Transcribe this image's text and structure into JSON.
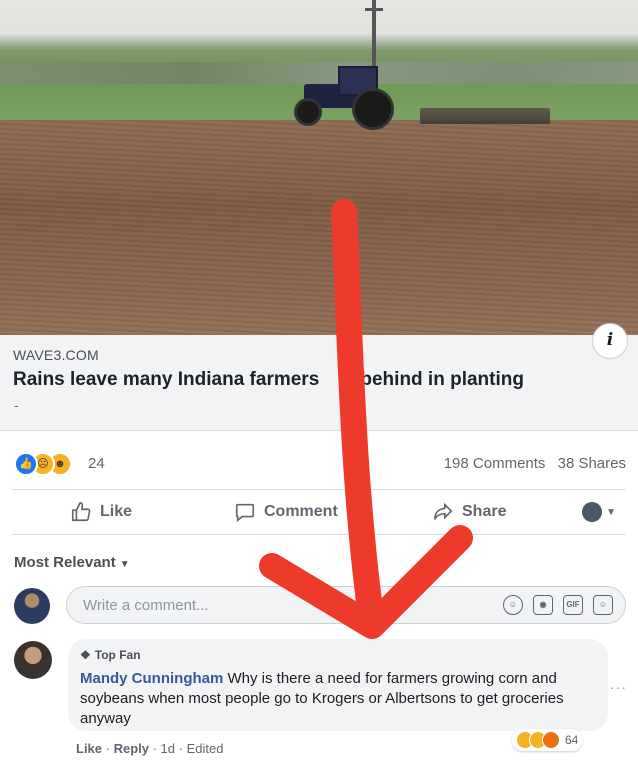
{
  "post": {
    "link_domain": "WAVE3.COM",
    "link_headline": "Rains leave many Indiana farmers ",
    "link_headline_cont": "ll behind in planting",
    "link_description": "-",
    "info_icon": "i"
  },
  "reactions": {
    "count": "24",
    "types": [
      "like-icon",
      "sad-icon",
      "haha-icon"
    ],
    "comments": "198 Comments",
    "shares": "38 Shares"
  },
  "actions": {
    "like": "Like",
    "comment": "Comment",
    "share": "Share"
  },
  "comments_section": {
    "sort_label": "Most Relevant",
    "composer_placeholder": "Write a comment...",
    "composer_icons": [
      "emoji-icon",
      "camera-icon",
      "gif-icon",
      "sticker-icon"
    ]
  },
  "comment": {
    "badge": "Top Fan",
    "author": "Mandy Cunningham",
    "text": " Why is there a need for farmers growing corn and soybeans when most people go to Krogers or Albertsons to get groceries anyway",
    "reaction_count": "64",
    "meta_like": "Like",
    "meta_reply": "Reply",
    "meta_time": "1d",
    "meta_edited": "Edited",
    "more": "···"
  },
  "colors": {
    "facebook_blue": "#1877f2",
    "link_color": "#385898",
    "annotation_arrow": "#ee3a2b"
  }
}
